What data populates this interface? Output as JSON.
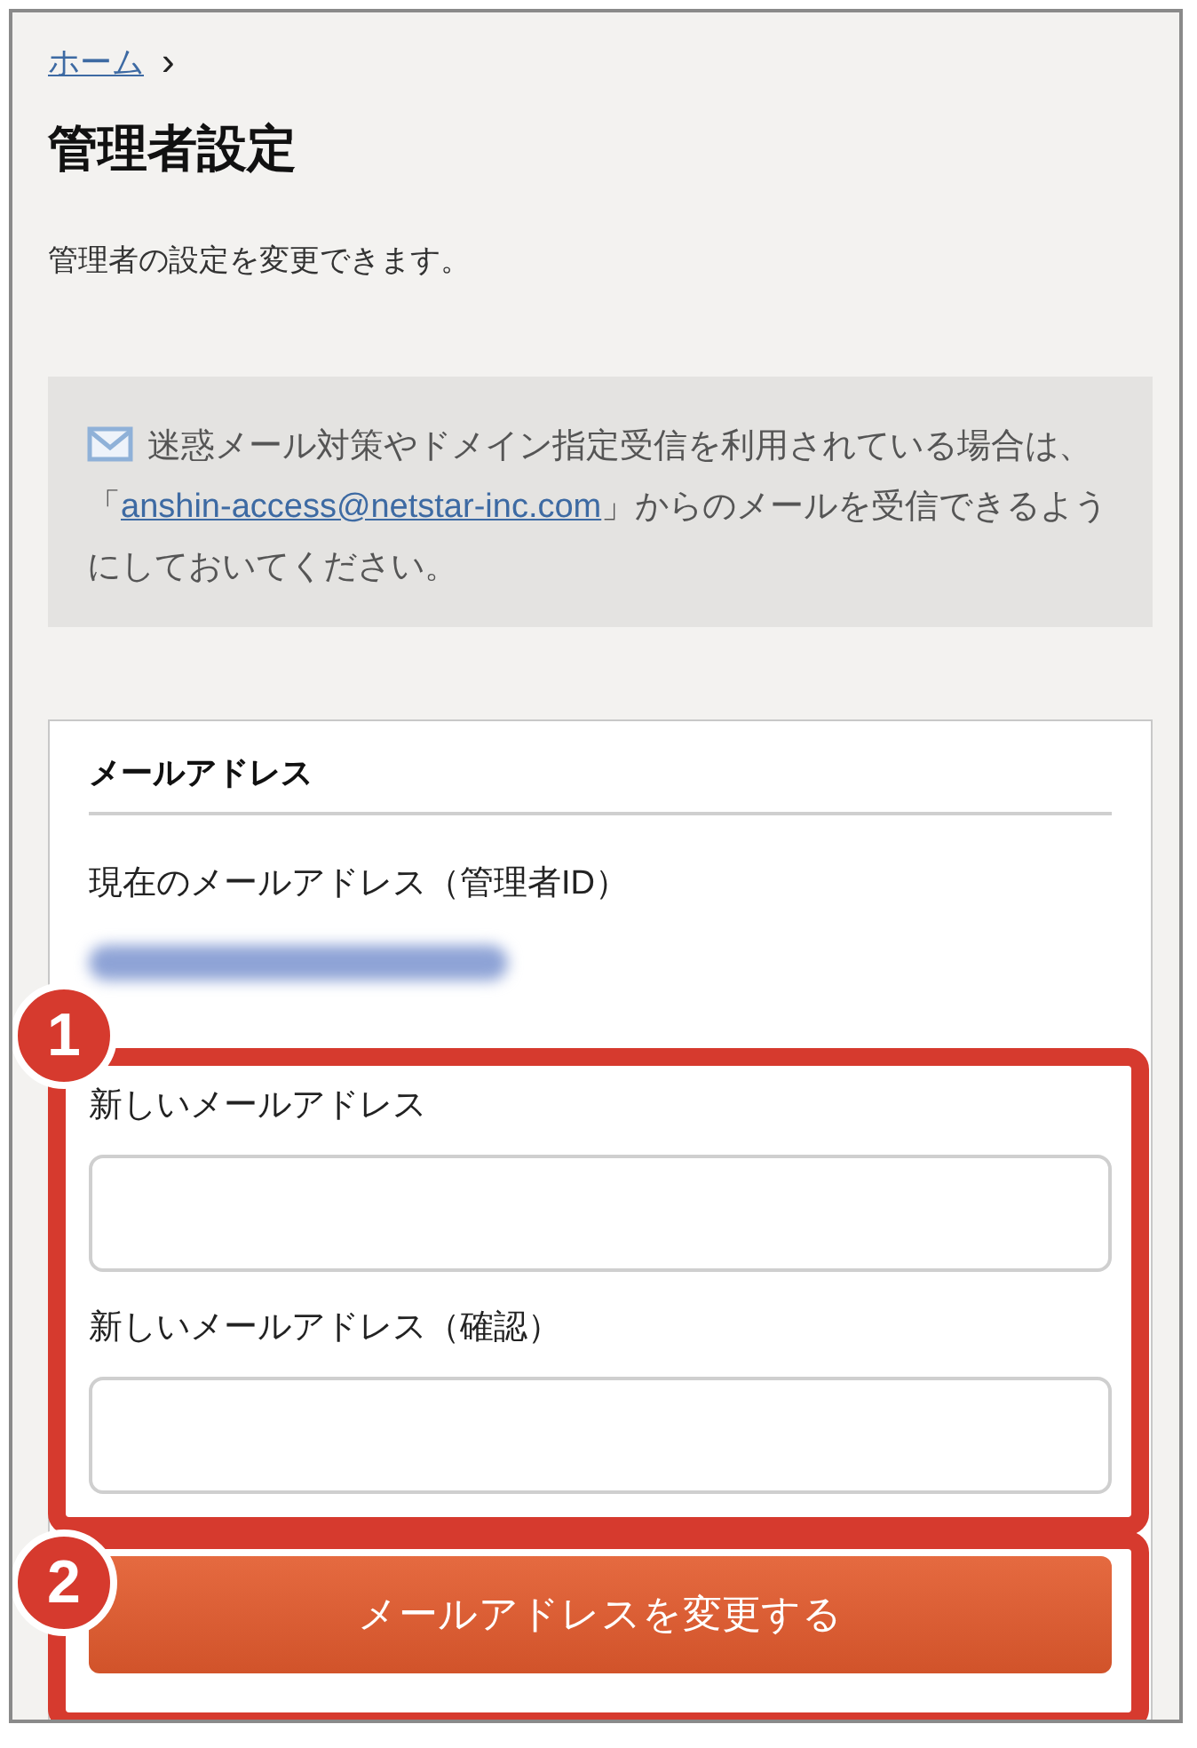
{
  "breadcrumb": {
    "link": "ホーム",
    "separator": "›"
  },
  "title": "管理者設定",
  "description": "管理者の設定を変更できます。",
  "notice": {
    "before": "迷惑メール対策やドメイン指定受信を利用されている場合は、「",
    "link": "anshin-access@netstar-inc.com",
    "after": "」からのメールを受信できるようにしておいてください。"
  },
  "card": {
    "heading": "メールアドレス",
    "current_label": "現在のメールアドレス（管理者ID）",
    "fields": [
      {
        "label": "新しいメールアドレス"
      },
      {
        "label": "新しいメールアドレス（確認）"
      }
    ],
    "submit": "メールアドレスを変更する"
  },
  "annotations": [
    {
      "number": "1"
    },
    {
      "number": "2"
    }
  ]
}
